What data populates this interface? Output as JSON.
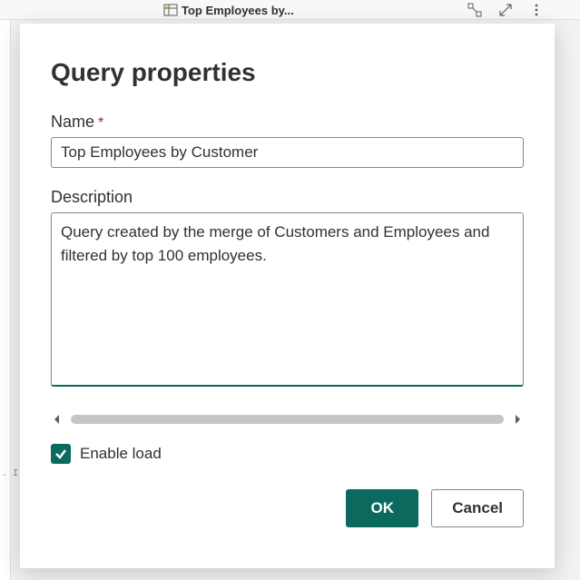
{
  "background": {
    "tab_title": "Top Employees by...",
    "side_text": ". I"
  },
  "dialog": {
    "title": "Query properties",
    "name": {
      "label": "Name",
      "required_marker": "*",
      "value": "Top Employees by Customer"
    },
    "description": {
      "label": "Description",
      "value": "Query created by the merge of Customers and Employees and filtered by top 100 employees."
    },
    "enable_load": {
      "label": "Enable load",
      "checked": true
    },
    "buttons": {
      "ok": "OK",
      "cancel": "Cancel"
    }
  }
}
